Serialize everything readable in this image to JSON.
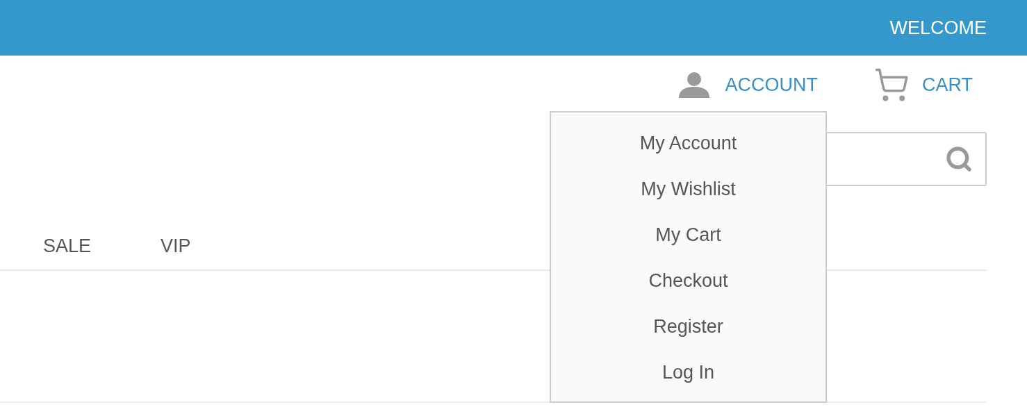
{
  "top_bar": {
    "welcome": "WELCOME"
  },
  "header": {
    "account_label": "ACCOUNT",
    "cart_label": "CART"
  },
  "nav": [
    "SALE",
    "VIP"
  ],
  "account_menu": {
    "expanded": true,
    "items": [
      "My Account",
      "My Wishlist",
      "My Cart",
      "Checkout",
      "Register",
      "Log In"
    ]
  }
}
